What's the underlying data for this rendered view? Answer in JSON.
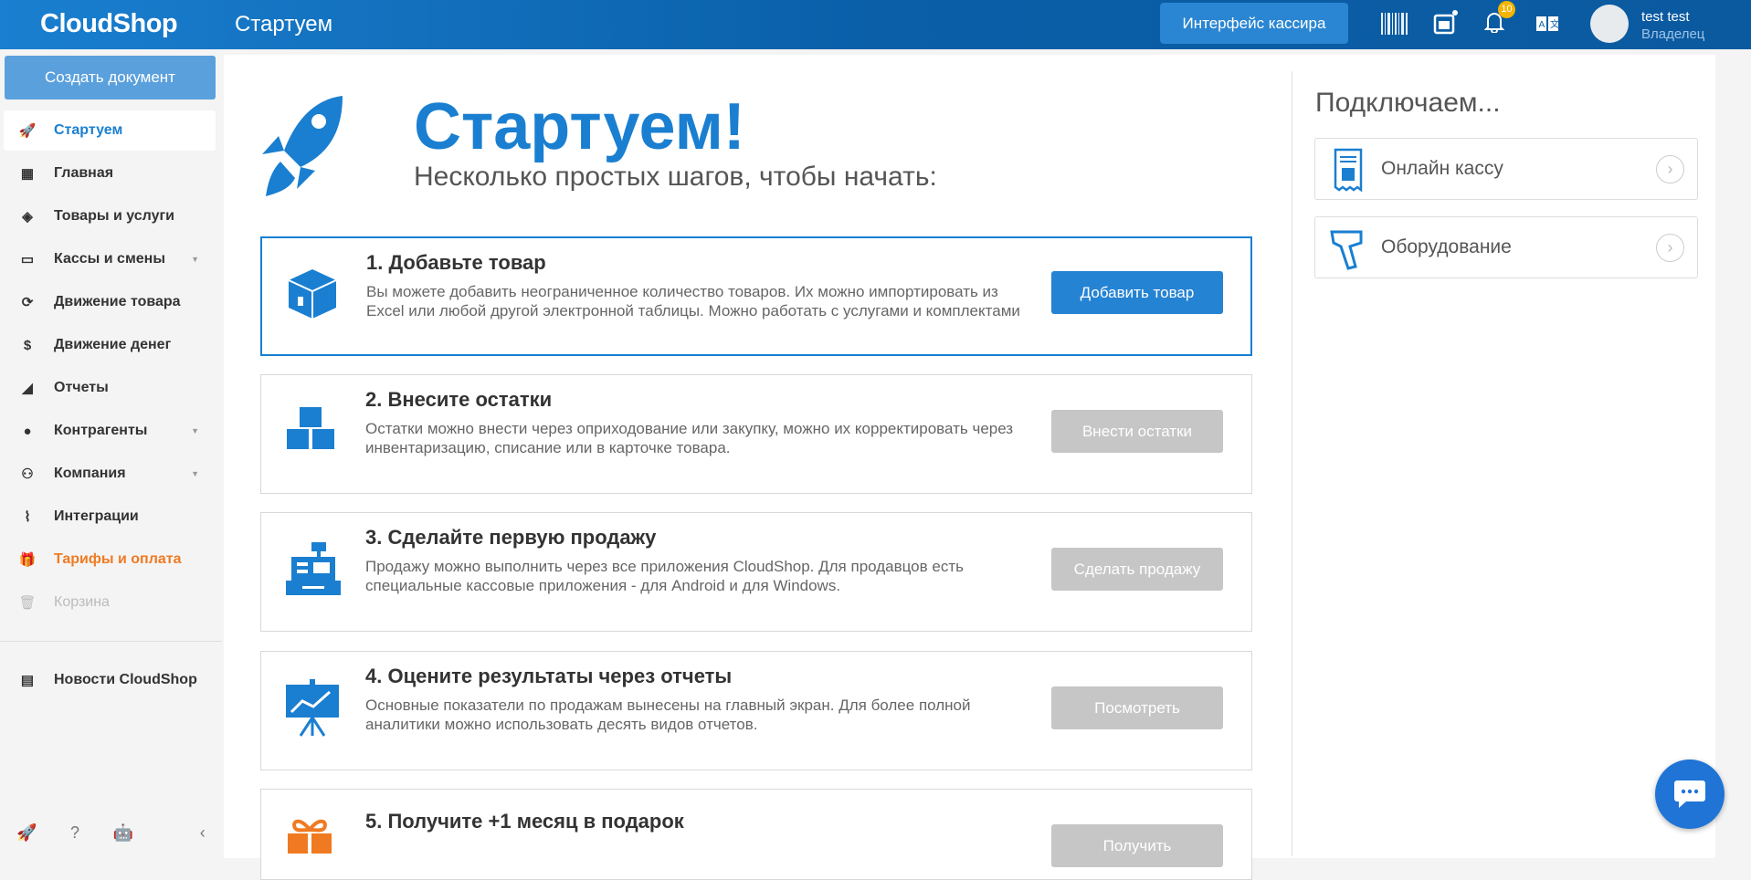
{
  "header": {
    "logo": "CloudShop",
    "title": "Стартуем",
    "cashier_button": "Интерфейс кассира",
    "notif_count": "10",
    "user_name": "test test",
    "user_role": "Владелец"
  },
  "sidebar": {
    "create_button": "Создать документ",
    "items": [
      {
        "label": "Стартуем",
        "icon": "rocket-icon"
      },
      {
        "label": "Главная",
        "icon": "grid-icon"
      },
      {
        "label": "Товары и услуги",
        "icon": "box-icon"
      },
      {
        "label": "Кассы и смены",
        "icon": "inbox-icon"
      },
      {
        "label": "Движение товара",
        "icon": "refresh-icon"
      },
      {
        "label": "Движение денег",
        "icon": "dollar-icon"
      },
      {
        "label": "Отчеты",
        "icon": "chart-icon"
      },
      {
        "label": "Контрагенты",
        "icon": "user-icon"
      },
      {
        "label": "Компания",
        "icon": "users-icon"
      },
      {
        "label": "Интеграции",
        "icon": "paperclip-icon"
      },
      {
        "label": "Тарифы и оплата",
        "icon": "gift-icon"
      },
      {
        "label": "Корзина",
        "icon": "trash-icon"
      }
    ],
    "news": "Новости CloudShop"
  },
  "main": {
    "title": "Стартуем!",
    "subtitle": "Несколько простых шагов, чтобы начать:",
    "steps": [
      {
        "title": "1. Добавьте товар",
        "desc": "Вы можете добавить неограниченное количество товаров. Их можно импортировать из Excel или любой другой электронной таблицы. Можно работать с услугами и комплектами",
        "button": "Добавить товар"
      },
      {
        "title": "2. Внесите остатки",
        "desc": "Остатки можно внести через оприходование или закупку, можно их корректировать через инвентаризацию, списание или в карточке товара.",
        "button": "Внести остатки"
      },
      {
        "title": "3. Сделайте первую продажу",
        "desc": "Продажу можно выполнить через все приложения CloudShop. Для продавцов есть специальные кассовые приложения - для Android и для Windows.",
        "button": "Сделать продажу"
      },
      {
        "title": "4. Оцените результаты через отчеты",
        "desc": "Основные показатели по продажам вынесены на главный экран. Для более полной аналитики можно использовать десять видов отчетов.",
        "button": "Посмотреть"
      },
      {
        "title": "5. Получите +1 месяц в подарок",
        "desc": "",
        "button": "Получить"
      }
    ]
  },
  "connect": {
    "title": "Подключаем...",
    "items": [
      {
        "label": "Онлайн кассу"
      },
      {
        "label": "Оборудование"
      }
    ]
  },
  "colors": {
    "accent": "#1a7fd0",
    "orange": "#f07a22"
  }
}
